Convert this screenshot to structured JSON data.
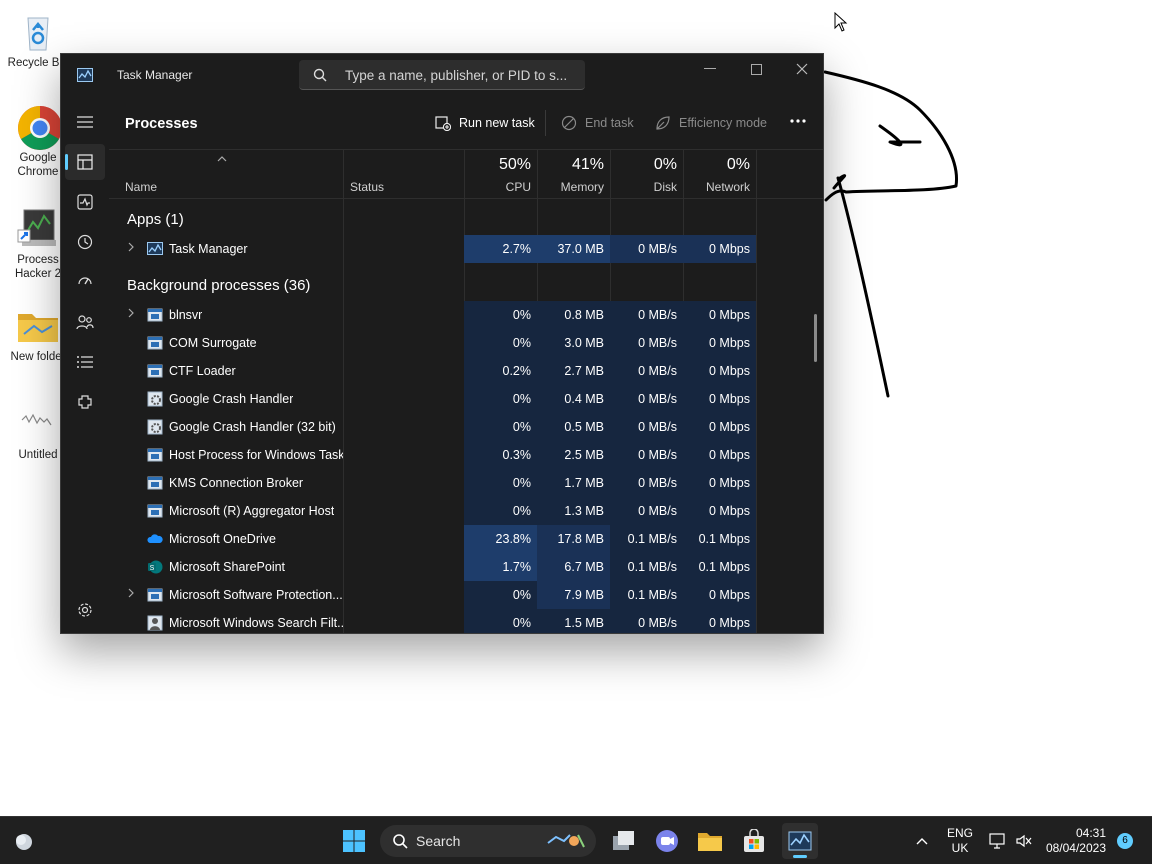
{
  "desktop": {
    "icons": [
      {
        "label": "Recycle Bin",
        "icon": "recycle-bin-icon"
      },
      {
        "label": "Google Chrome",
        "icon": "chrome-icon"
      },
      {
        "label": "Process Hacker 2",
        "icon": "process-hacker-icon"
      },
      {
        "label": "New folder",
        "icon": "folder-icon"
      },
      {
        "label": "Untitled",
        "icon": "image-file-icon"
      }
    ]
  },
  "window": {
    "title": "Task Manager",
    "search_placeholder": "Type a name, publisher, or PID to s..."
  },
  "nav": [
    "hamburger-icon",
    "processes-icon",
    "performance-icon",
    "app-history-icon",
    "startup-apps-icon",
    "users-icon",
    "details-icon",
    "services-icon",
    "settings-icon"
  ],
  "toolbar": {
    "page_title": "Processes",
    "run_new_task": "Run new task",
    "end_task": "End task",
    "efficiency_mode": "Efficiency mode",
    "more": "..."
  },
  "columns": {
    "name": "Name",
    "status": "Status",
    "cpu": {
      "pct": "50%",
      "label": "CPU"
    },
    "memory": {
      "pct": "41%",
      "label": "Memory"
    },
    "disk": {
      "pct": "0%",
      "label": "Disk"
    },
    "network": {
      "pct": "0%",
      "label": "Network"
    }
  },
  "groups": {
    "apps": "Apps (1)",
    "background": "Background processes (36)"
  },
  "apps": [
    {
      "name": "Task Manager",
      "cpu": "2.7%",
      "memory": "37.0 MB",
      "disk": "0 MB/s",
      "network": "0 Mbps",
      "expandable": true,
      "icon": "taskmgr"
    }
  ],
  "background": [
    {
      "name": "blnsvr",
      "cpu": "0%",
      "memory": "0.8 MB",
      "disk": "0 MB/s",
      "network": "0 Mbps",
      "expandable": true,
      "icon": "window"
    },
    {
      "name": "COM Surrogate",
      "cpu": "0%",
      "memory": "3.0 MB",
      "disk": "0 MB/s",
      "network": "0 Mbps",
      "expandable": false,
      "icon": "window"
    },
    {
      "name": "CTF Loader",
      "cpu": "0.2%",
      "memory": "2.7 MB",
      "disk": "0 MB/s",
      "network": "0 Mbps",
      "expandable": false,
      "icon": "window"
    },
    {
      "name": "Google Crash Handler",
      "cpu": "0%",
      "memory": "0.4 MB",
      "disk": "0 MB/s",
      "network": "0 Mbps",
      "expandable": false,
      "icon": "gear"
    },
    {
      "name": "Google Crash Handler (32 bit)",
      "cpu": "0%",
      "memory": "0.5 MB",
      "disk": "0 MB/s",
      "network": "0 Mbps",
      "expandable": false,
      "icon": "gear"
    },
    {
      "name": "Host Process for Windows Tasks",
      "cpu": "0.3%",
      "memory": "2.5 MB",
      "disk": "0 MB/s",
      "network": "0 Mbps",
      "expandable": false,
      "icon": "window"
    },
    {
      "name": "KMS Connection Broker",
      "cpu": "0%",
      "memory": "1.7 MB",
      "disk": "0 MB/s",
      "network": "0 Mbps",
      "expandable": false,
      "icon": "window"
    },
    {
      "name": "Microsoft (R) Aggregator Host",
      "cpu": "0%",
      "memory": "1.3 MB",
      "disk": "0 MB/s",
      "network": "0 Mbps",
      "expandable": false,
      "icon": "window"
    },
    {
      "name": "Microsoft OneDrive",
      "cpu": "23.8%",
      "memory": "17.8 MB",
      "disk": "0.1 MB/s",
      "network": "0.1 Mbps",
      "expandable": false,
      "icon": "cloud"
    },
    {
      "name": "Microsoft SharePoint",
      "cpu": "1.7%",
      "memory": "6.7 MB",
      "disk": "0.1 MB/s",
      "network": "0.1 Mbps",
      "expandable": false,
      "icon": "sharepoint"
    },
    {
      "name": "Microsoft Software Protection...",
      "cpu": "0%",
      "memory": "7.9 MB",
      "disk": "0.1 MB/s",
      "network": "0 Mbps",
      "expandable": true,
      "icon": "window"
    },
    {
      "name": "Microsoft Windows Search Filt...",
      "cpu": "0%",
      "memory": "1.5 MB",
      "disk": "0 MB/s",
      "network": "0 Mbps",
      "expandable": false,
      "icon": "person"
    }
  ],
  "taskbar": {
    "search_label": "Search",
    "lang_top": "ENG",
    "lang_bottom": "UK",
    "time": "04:31",
    "date": "08/04/2023",
    "notification_count": "6"
  },
  "colors": {
    "accent": "#60cdff",
    "window_bg": "#1c1c1c",
    "heat_low": "#16263f",
    "heat_high": "#1e3d6b"
  }
}
